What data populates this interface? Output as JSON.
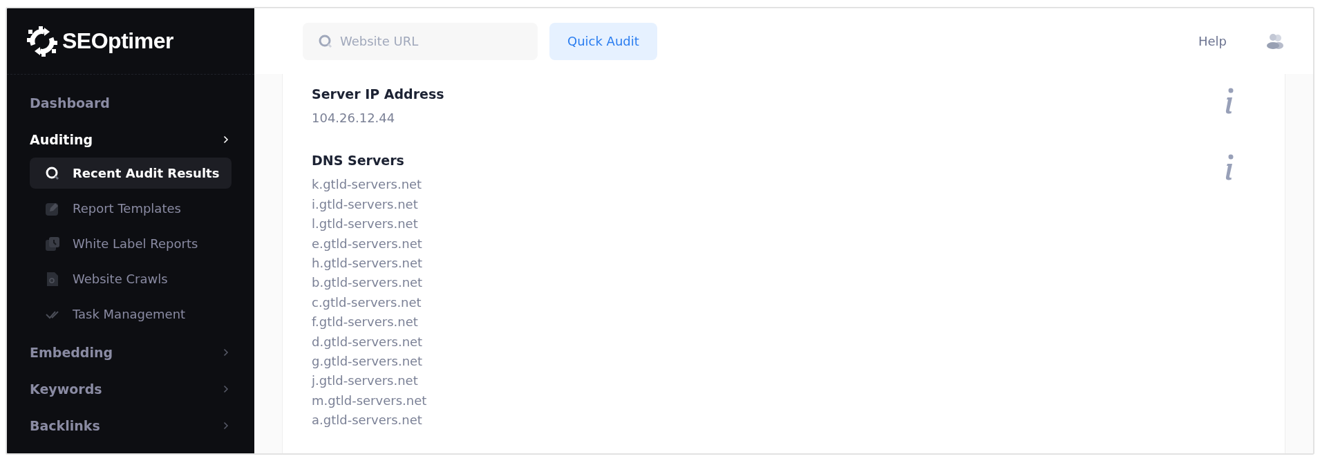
{
  "logo": {
    "text": "SEOptimer"
  },
  "sidebar": {
    "items": [
      {
        "label": "Dashboard",
        "selected": false
      },
      {
        "label": "Auditing",
        "selected": false,
        "expanded": true,
        "children": [
          {
            "label": "Recent Audit Results",
            "selected": true
          },
          {
            "label": "Report Templates",
            "selected": false
          },
          {
            "label": "White Label Reports",
            "selected": false
          },
          {
            "label": "Website Crawls",
            "selected": false
          },
          {
            "label": "Task Management",
            "selected": false
          }
        ]
      },
      {
        "label": "Embedding",
        "selected": false,
        "expanded": false
      },
      {
        "label": "Keywords",
        "selected": false,
        "expanded": false
      },
      {
        "label": "Backlinks",
        "selected": false,
        "expanded": false
      }
    ]
  },
  "header": {
    "search": {
      "placeholder": "Website URL"
    },
    "audit_button": "Quick Audit",
    "help_link": "Help"
  },
  "sections": [
    {
      "title": "Server IP Address",
      "values": [
        "104.26.12.44"
      ]
    },
    {
      "title": "DNS Servers",
      "values": [
        "k.gtld-servers.net",
        "i.gtld-servers.net",
        "l.gtld-servers.net",
        "e.gtld-servers.net",
        "h.gtld-servers.net",
        "b.gtld-servers.net",
        "c.gtld-servers.net",
        "f.gtld-servers.net",
        "d.gtld-servers.net",
        "g.gtld-servers.net",
        "j.gtld-servers.net",
        "m.gtld-servers.net",
        "a.gtld-servers.net"
      ]
    }
  ]
}
